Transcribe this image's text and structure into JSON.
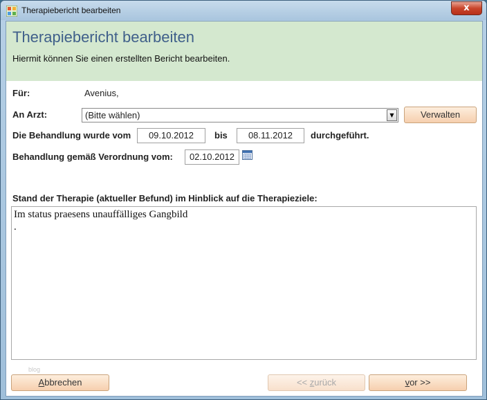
{
  "window": {
    "title": "Therapiebericht bearbeiten",
    "close_glyph": "x"
  },
  "header": {
    "title": "Therapiebericht bearbeiten",
    "subtitle": "Hiermit können Sie einen erstellten Bericht bearbeiten."
  },
  "form": {
    "fuer_label": "Für:",
    "fuer_value": "Avenius,",
    "arzt_label": "An Arzt:",
    "arzt_selected": "(Bitte wählen)",
    "verwalten_label": "Verwalten",
    "behandlung_label": "Die Behandlung wurde vom",
    "date_from": "09.10.2012",
    "bis_label": "bis",
    "date_to": "08.11.2012",
    "durchgefuehrt_label": "durchgeführt.",
    "verordnung_label": "Behandlung gemäß Verordnung vom:",
    "verordnung_date": "02.10.2012",
    "stand_label": "Stand der Therapie  (aktueller  Befund)  im  Hinblick auf die Therapieziele:",
    "befund_text": "Im status praesens unauffälliges Gangbild\n."
  },
  "watermark": "blog",
  "footer": {
    "abbrechen_first": "A",
    "abbrechen_rest": "bbrechen",
    "zurueck_pre": "<< ",
    "zurueck_u": "z",
    "zurueck_rest": "urück",
    "vor_u": "v",
    "vor_rest": "or >>"
  },
  "colors": {
    "header_bg": "#d4e8cf",
    "title_color": "#3f5f8a",
    "button_bg": "#f6cfae"
  }
}
